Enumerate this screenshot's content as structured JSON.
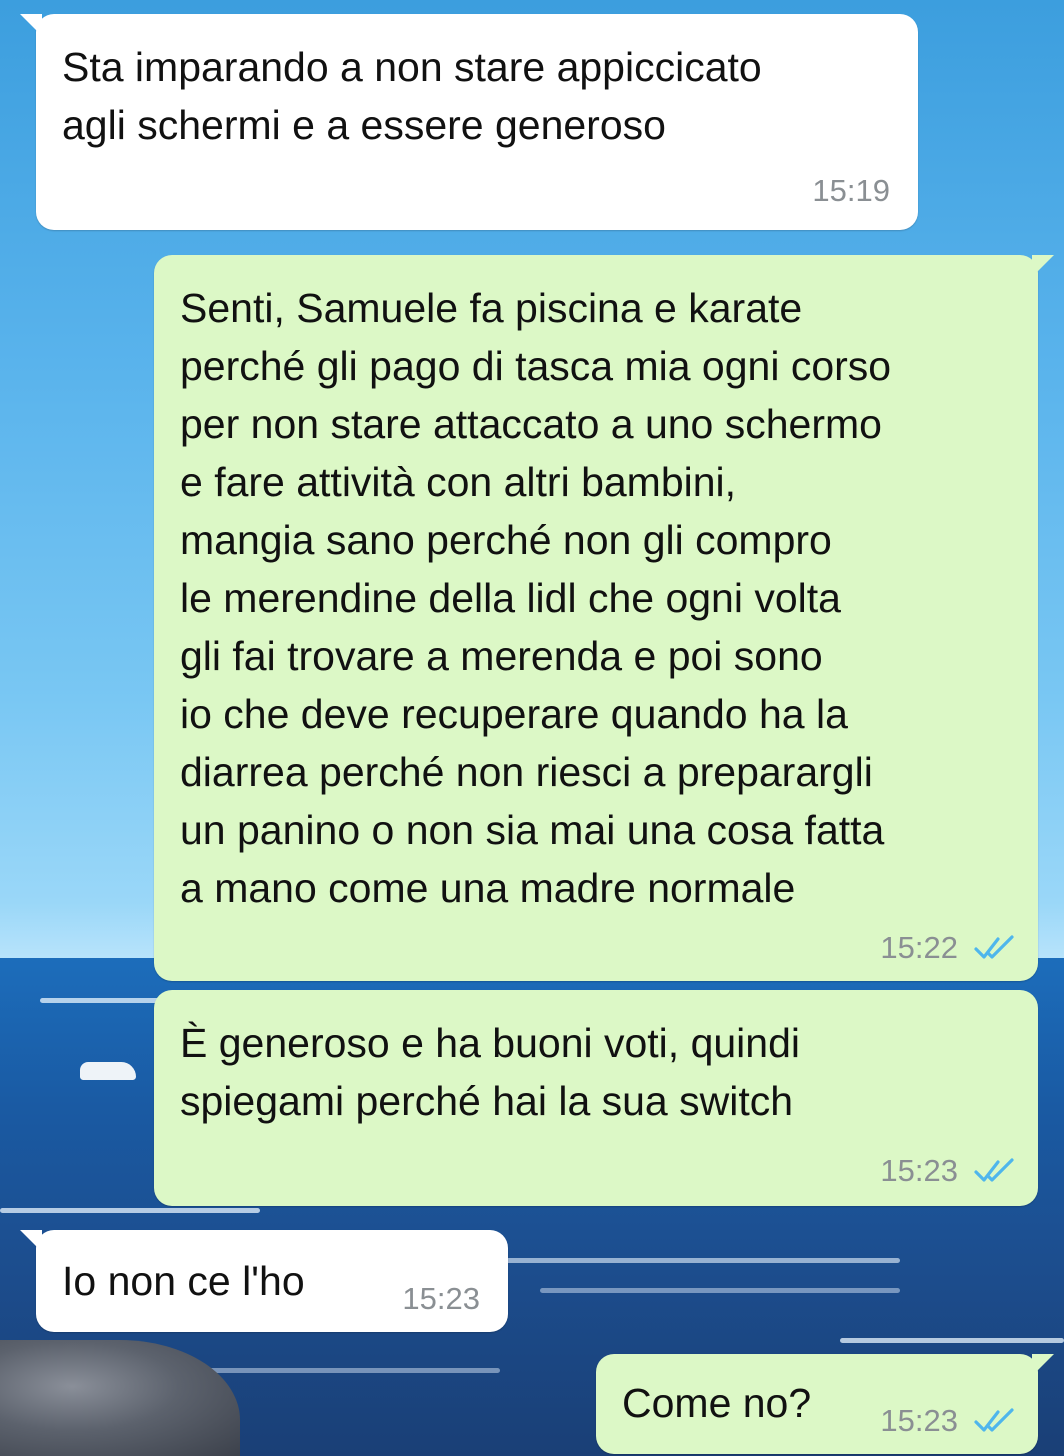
{
  "messages": [
    {
      "direction": "incoming",
      "text": "Sta imparando a non stare appiccicato\nagli schermi e a essere generoso",
      "time": "15:19"
    },
    {
      "direction": "outgoing",
      "text": "Senti, Samuele fa piscina e karate\nperché gli pago di tasca mia ogni corso\nper non stare attaccato a uno schermo\ne fare attività con altri bambini,\nmangia sano perché non gli compro\nle merendine della lidl che ogni volta\ngli fai trovare a merenda e poi sono\nio che deve recuperare quando ha la\ndiarrea perché non riesci a preparargli\nun panino o non sia mai una cosa fatta\na mano come una madre normale",
      "time": "15:22",
      "status": "read"
    },
    {
      "direction": "outgoing",
      "text": "È generoso e ha buoni voti, quindi\nspiegami perché hai la sua switch",
      "time": "15:23",
      "status": "read"
    },
    {
      "direction": "incoming",
      "text": "Io non ce l'ho",
      "time": "15:23"
    },
    {
      "direction": "outgoing",
      "text": "Come no?",
      "time": "15:23",
      "status": "read"
    }
  ],
  "colors": {
    "incoming_bubble": "#ffffff",
    "outgoing_bubble": "#dcf8c6",
    "read_ticks": "#4fb6ec",
    "timestamp": "#8a8f93"
  },
  "icons": {
    "read_status": "double-check-icon"
  }
}
